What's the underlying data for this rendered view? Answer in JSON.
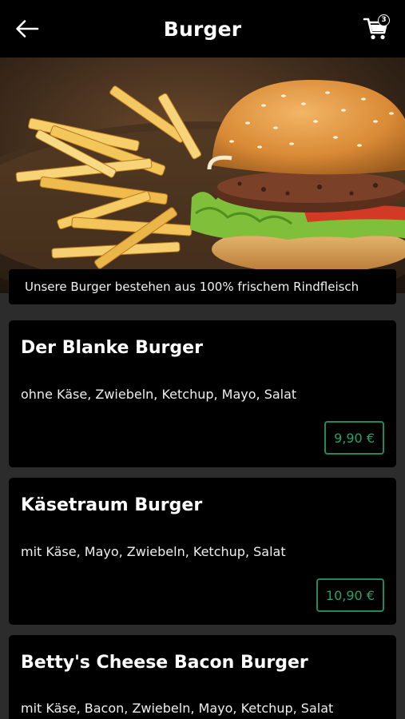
{
  "header": {
    "title": "Burger",
    "cart_count": "3"
  },
  "hero": {
    "caption": "Unsere Burger bestehen aus 100% frischem Rindfleisch"
  },
  "products": [
    {
      "name": "Der Blanke Burger",
      "description": "ohne Käse, Zwiebeln, Ketchup, Mayo, Salat",
      "price": "9,90 €"
    },
    {
      "name": "Käsetraum Burger",
      "description": "mit Käse, Mayo, Zwiebeln, Ketchup, Salat",
      "price": "10,90 €"
    },
    {
      "name": "Betty's Cheese Bacon Burger",
      "description": "mit Käse, Bacon, Zwiebeln, Mayo, Ketchup, Salat"
    }
  ],
  "colors": {
    "accent": "#27a36a",
    "header_bg": "#000000",
    "page_bg": "#2c2c2c"
  },
  "icons": {
    "back": "arrow-left-icon",
    "cart": "shopping-cart-icon"
  }
}
